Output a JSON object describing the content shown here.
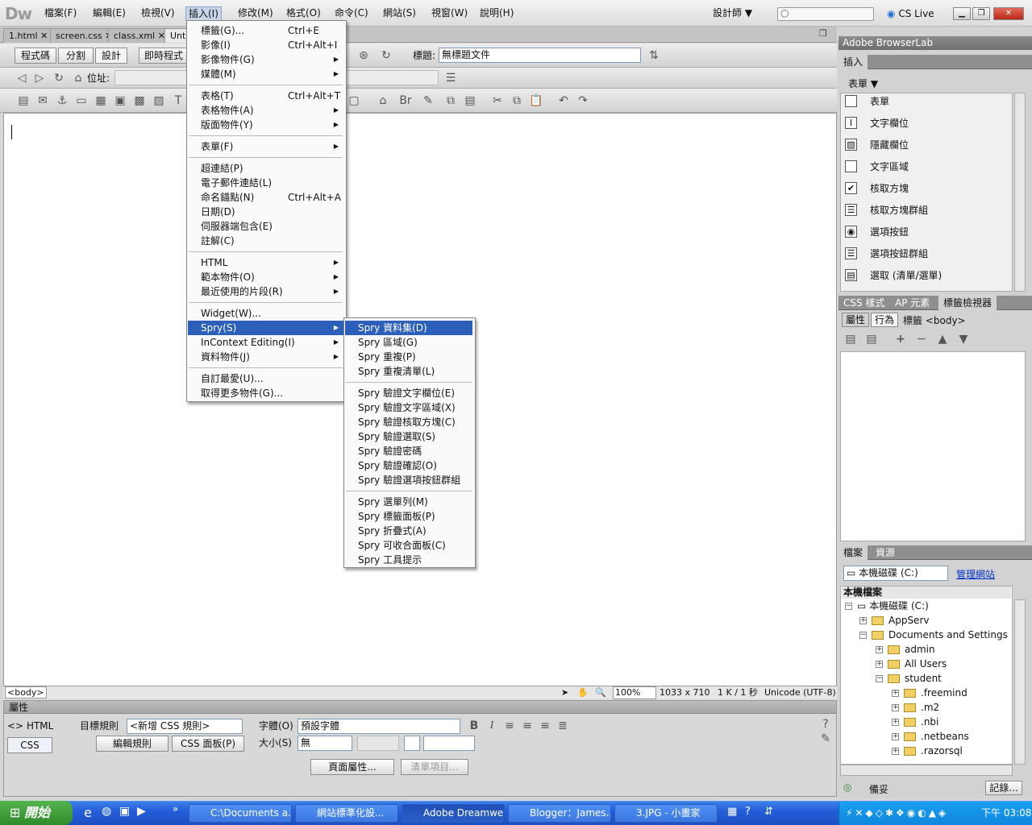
{
  "app": {
    "logo": "Dw",
    "workspace": "設計師",
    "cslive": "CS Live"
  },
  "menubar": [
    "檔案(F)",
    "編輯(E)",
    "檢視(V)",
    "插入(I)",
    "修改(M)",
    "格式(O)",
    "命令(C)",
    "網站(S)",
    "視窗(W)",
    "說明(H)"
  ],
  "doc_tabs": [
    "1.html",
    "screen.css",
    "class.xml",
    "Unti"
  ],
  "view_buttons": {
    "code": "程式碼",
    "split": "分割",
    "design": "設計",
    "live": "即時程式"
  },
  "title_label": "標題:",
  "title_value": "無標題文件",
  "address_label": "位址:",
  "status": {
    "tag": "<body>",
    "zoom": "100%",
    "size": "1033 x 710",
    "weight": "1 K / 1 秒",
    "encoding": "Unicode (UTF-8)"
  },
  "properties": {
    "header": "屬性",
    "html_btn": "HTML",
    "css_btn": "CSS",
    "target_rule_label": "目標規則",
    "target_rule_value": "<新增 CSS 規則>",
    "edit_rule": "編輯規則",
    "css_panel": "CSS 面板(P)",
    "font_label": "字體(O)",
    "font_value": "預設字體",
    "size_label": "大小(S)",
    "size_value": "無",
    "page_props": "頁面屬性...",
    "list_item": "清單項目..."
  },
  "insert_menu": [
    {
      "label": "標籤(G)...",
      "shortcut": "Ctrl+E"
    },
    {
      "label": "影像(I)",
      "shortcut": "Ctrl+Alt+I"
    },
    {
      "label": "影像物件(G)",
      "arrow": true
    },
    {
      "label": "媒體(M)",
      "arrow": true
    },
    {
      "sep": true
    },
    {
      "label": "表格(T)",
      "shortcut": "Ctrl+Alt+T"
    },
    {
      "label": "表格物件(A)",
      "arrow": true
    },
    {
      "label": "版面物件(Y)",
      "arrow": true
    },
    {
      "sep": true
    },
    {
      "label": "表單(F)",
      "arrow": true
    },
    {
      "sep": true
    },
    {
      "label": "超連結(P)"
    },
    {
      "label": "電子郵件連結(L)"
    },
    {
      "label": "命名錨點(N)",
      "shortcut": "Ctrl+Alt+A"
    },
    {
      "label": "日期(D)"
    },
    {
      "label": "伺服器端包含(E)"
    },
    {
      "label": "註解(C)"
    },
    {
      "sep": true
    },
    {
      "label": "HTML",
      "arrow": true
    },
    {
      "label": "範本物件(O)",
      "arrow": true
    },
    {
      "label": "最近使用的片段(R)",
      "arrow": true
    },
    {
      "sep": true
    },
    {
      "label": "Widget(W)..."
    },
    {
      "label": "Spry(S)",
      "arrow": true,
      "hl": true
    },
    {
      "label": "InContext Editing(I)",
      "arrow": true
    },
    {
      "label": "資料物件(J)",
      "arrow": true
    },
    {
      "sep": true
    },
    {
      "label": "自訂最愛(U)..."
    },
    {
      "label": "取得更多物件(G)..."
    }
  ],
  "spry_menu": [
    {
      "label": "Spry 資料集(D)",
      "hl": true
    },
    {
      "label": "Spry 區域(G)"
    },
    {
      "label": "Spry 重複(P)"
    },
    {
      "label": "Spry 重複清單(L)"
    },
    {
      "sep": true
    },
    {
      "label": "Spry 驗證文字欄位(E)"
    },
    {
      "label": "Spry 驗證文字區域(X)"
    },
    {
      "label": "Spry 驗證核取方塊(C)"
    },
    {
      "label": "Spry 驗證選取(S)"
    },
    {
      "label": "Spry 驗證密碼"
    },
    {
      "label": "Spry 驗證確認(O)"
    },
    {
      "label": "Spry 驗證選項按鈕群組"
    },
    {
      "sep": true
    },
    {
      "label": "Spry 選單列(M)"
    },
    {
      "label": "Spry 標籤面板(P)"
    },
    {
      "label": "Spry 折疊式(A)"
    },
    {
      "label": "Spry 可收合面板(C)"
    },
    {
      "label": "Spry 工具提示"
    }
  ],
  "right": {
    "browserlab": "Adobe BrowserLab",
    "insert_title": "插入",
    "insert_category": "表單",
    "insert_items": [
      "表單",
      "文字欄位",
      "隱藏欄位",
      "文字區域",
      "核取方塊",
      "核取方塊群組",
      "選項按鈕",
      "選項按鈕群組",
      "選取 (清單/選單)"
    ],
    "css_tabs": [
      "CSS 樣式",
      "AP 元素",
      "標籤檢視器"
    ],
    "attr_tab": "屬性",
    "behavior_tab": "行為",
    "tag_label": "標籤 <body>",
    "files_tabs": [
      "檔案",
      "資源"
    ],
    "drive": "本機磁碟 (C:)",
    "manage": "管理網站",
    "local_files": "本機檔案",
    "tree": [
      "本機磁碟 (C:)",
      "AppServ",
      "Documents and Settings",
      "admin",
      "All Users",
      "student",
      ".freemind",
      ".m2",
      ".nbi",
      ".netbeans",
      ".razorsql"
    ],
    "ready": "備妥",
    "log": "記錄..."
  },
  "taskbar": {
    "start": "開始",
    "tasks": [
      "C:\\Documents a...",
      "網站標準化設...",
      "Adobe Dreamwe...",
      "Blogger：James...",
      "3.JPG - 小畫家"
    ],
    "clock": "下午 03:08"
  }
}
